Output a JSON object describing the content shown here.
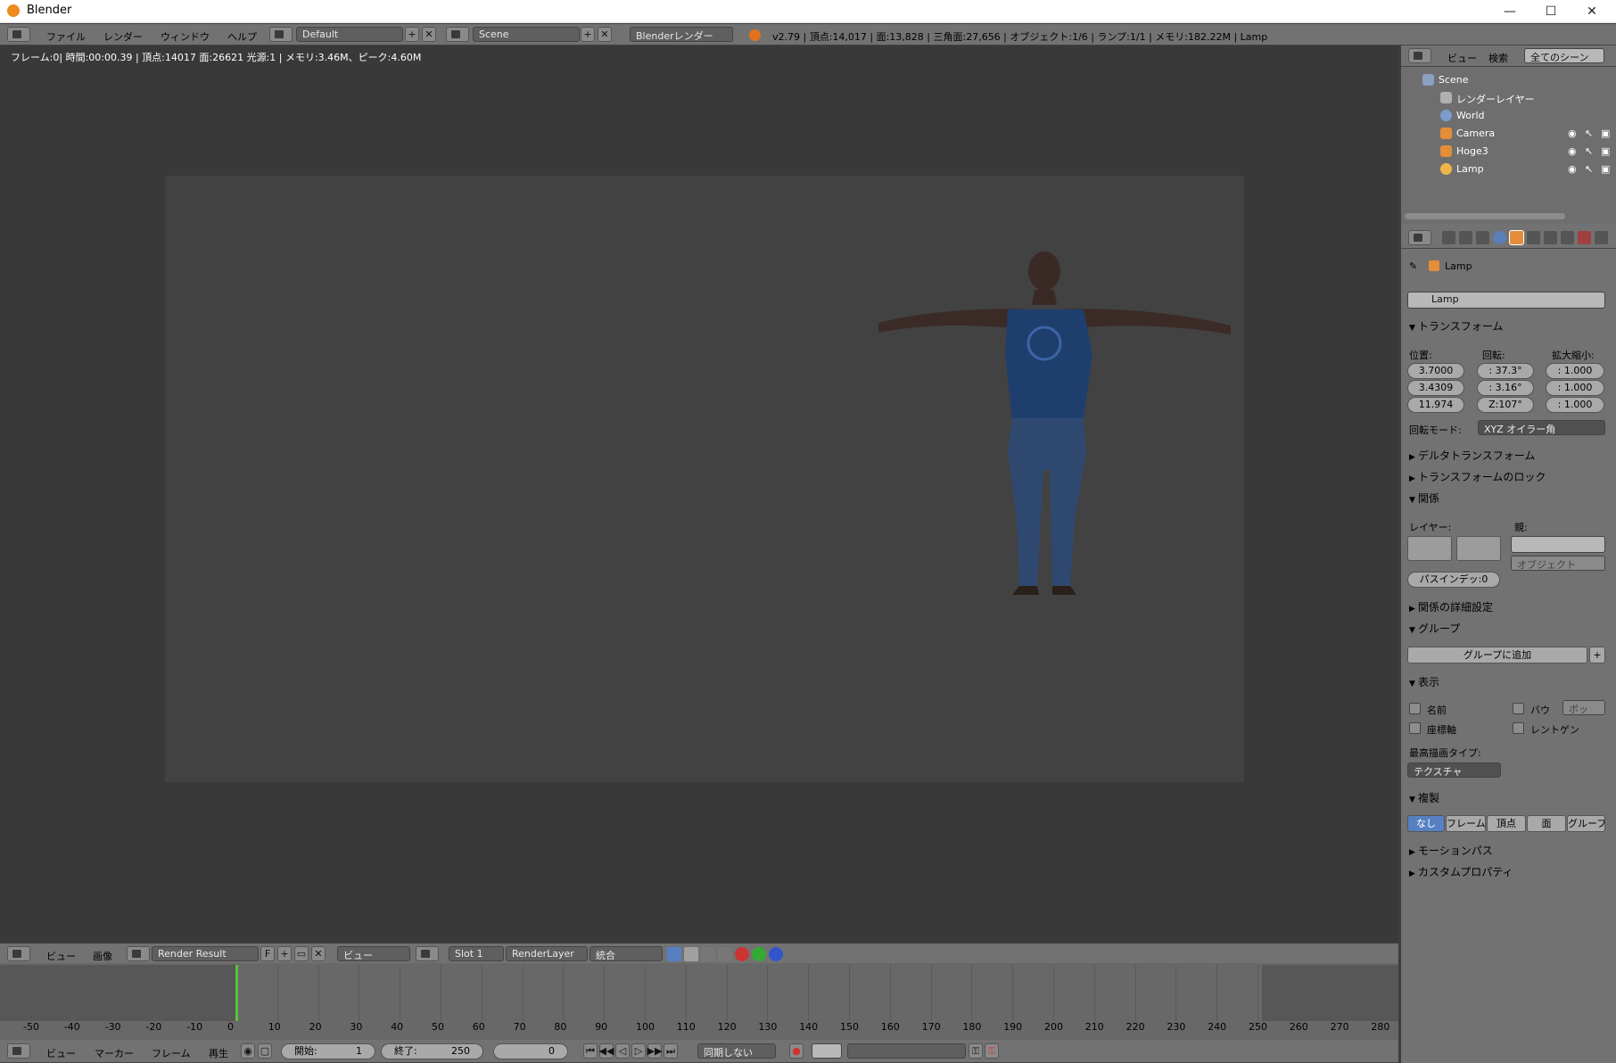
{
  "window": {
    "title": "Blender"
  },
  "top_menu": {
    "items": [
      "ファイル",
      "レンダー",
      "ウィンドウ",
      "ヘルプ"
    ],
    "screen_layout": "Default",
    "scene": "Scene",
    "engine": "Blenderレンダー",
    "stats": "v2.79 | 頂点:14,017 | 面:13,828 | 三角面:27,656 | オブジェクト:1/6 | ランプ:1/1 | メモリ:182.22M | Lamp"
  },
  "viewport": {
    "render_info": "フレーム:0| 時間:00:00.39 | 頂点:14017 面:26621 光源:1 | メモリ:3.46M、ピーク:4.60M"
  },
  "outliner": {
    "tabs": [
      "ビュー",
      "検索"
    ],
    "scope": "全てのシーン",
    "items": [
      {
        "label": "Scene"
      },
      {
        "label": "レンダーレイヤー"
      },
      {
        "label": "World"
      },
      {
        "label": "Camera"
      },
      {
        "label": "Hoge3"
      },
      {
        "label": "Lamp"
      }
    ]
  },
  "properties": {
    "breadcrumb_object": "Lamp",
    "object_name": "Lamp",
    "transform": {
      "title": "トランスフォーム",
      "location_label": "位置:",
      "rotation_label": "回転:",
      "scale_label": "拡大縮小:",
      "location": [
        "3.7000",
        "3.4309",
        "11.974"
      ],
      "rotation": [
        ": 37.3°",
        ": 3.16°",
        "Z:107°"
      ],
      "scale": [
        ": 1.000",
        ": 1.000",
        ": 1.000"
      ],
      "rotation_mode_label": "回転モード:",
      "rotation_mode": "XYZ オイラー角"
    },
    "collapsed_sections": [
      "デルタトランスフォーム",
      "トランスフォームのロック"
    ],
    "relations": {
      "title": "関係",
      "layers_label": "レイヤー:",
      "parent_label": "親:",
      "parent_type": "オブジェクト",
      "pass_index": "パスインデッ:0"
    },
    "relations_extras": "関係の詳細設定",
    "groups": {
      "title": "グループ",
      "add_button": "グループに追加"
    },
    "display": {
      "title": "表示",
      "name": "名前",
      "bounds": "バウ",
      "bounds_type": "ボッ",
      "axis": "座標軸",
      "xray": "レントゲン",
      "max_draw_type_label": "最高描画タイプ:",
      "max_draw_type": "テクスチャ"
    },
    "duplication": {
      "title": "複製",
      "options": [
        "なし",
        "フレーム",
        "頂点",
        "面",
        "グループ"
      ],
      "active": "なし"
    },
    "motion_paths": "モーションパス",
    "custom_props": "カスタムプロパティ"
  },
  "image_editor_header": {
    "view": "ビュー",
    "image": "画像",
    "image_name": "Render Result",
    "f_label": "F",
    "view_dropdown": "ビュー",
    "slot": "Slot 1",
    "layer": "RenderLayer",
    "pass": "統合"
  },
  "timeline": {
    "ticks": [
      "-50",
      "-40",
      "-30",
      "-20",
      "-10",
      "0",
      "10",
      "20",
      "30",
      "40",
      "50",
      "60",
      "70",
      "80",
      "90",
      "100",
      "110",
      "120",
      "130",
      "140",
      "150",
      "160",
      "170",
      "180",
      "190",
      "200",
      "210",
      "220",
      "230",
      "240",
      "250",
      "260",
      "270",
      "280"
    ],
    "current_frame_value": 0
  },
  "timeline_header": {
    "view": "ビュー",
    "marker": "マーカー",
    "frame": "フレーム",
    "playback": "再生",
    "start_label": "開始:",
    "start": "1",
    "end_label": "終了:",
    "end": "250",
    "current": "0",
    "sync": "同期しない"
  },
  "colors": {
    "accent": "#5680c2",
    "frame_cursor": "#57c23b",
    "shirt": "#1e3f6e"
  }
}
